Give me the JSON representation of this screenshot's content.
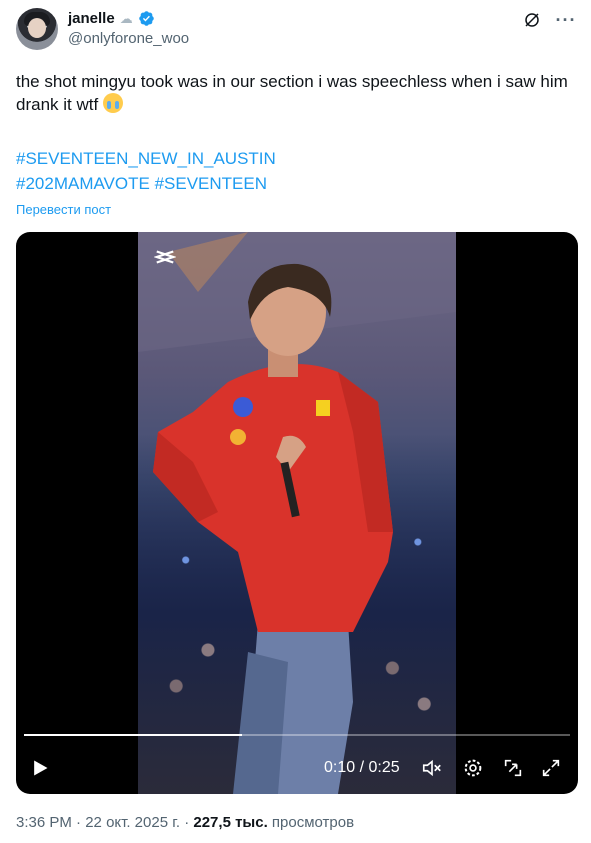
{
  "author": {
    "display_name": "janelle",
    "status_emoji": "cloud-icon",
    "handle": "@onlyforone_woo",
    "verified": true
  },
  "header_icons": [
    "grok-icon",
    "more-icon"
  ],
  "more_label": "···",
  "tweet": {
    "text": "the shot mingyu took was in our section i was speechless when i saw him drank it wtf",
    "hashtags_line1": "#SEVENTEEN_NEW_IN_AUSTIN",
    "hashtag_2": "#202MAMAVOTE",
    "hashtag_3": "#SEVENTEEN",
    "translate_label": "Перевести пост"
  },
  "video": {
    "current_time": "0:10",
    "separator": " / ",
    "duration": "0:25",
    "progress": 0.4,
    "watermark": "capcut-logo-icon"
  },
  "footer": {
    "time": "3:36 PM",
    "date": "22 окт. 2025 г.",
    "dot": " · ",
    "views_count": "227,5 тыс.",
    "views_label": "просмотров"
  },
  "colors": {
    "link": "#1d9bf0",
    "verified": "#1d9bf0",
    "secondary_text": "#536471"
  }
}
